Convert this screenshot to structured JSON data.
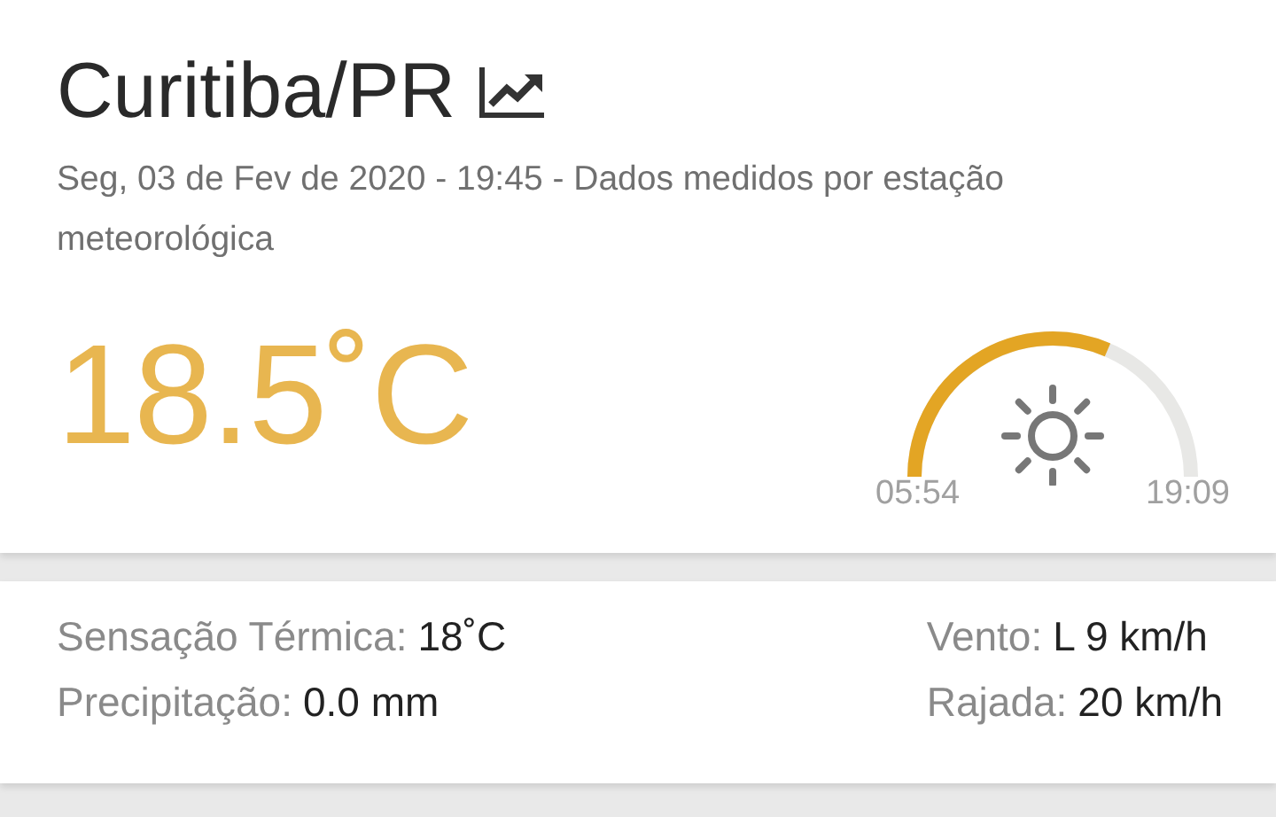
{
  "city": "Curitiba/PR",
  "subtitle": "Seg, 03 de Fev de 2020 - 19:45 - Dados medidos por estação meteorológica",
  "temperature": "18.5˚C",
  "sun": {
    "sunrise": "05:54",
    "sunset": "19:09"
  },
  "stats": [
    {
      "label": "Sensação Térmica:",
      "value": "18˚C"
    },
    {
      "label": "Vento:",
      "value": "L 9 km/h"
    },
    {
      "label": "Precipitação:",
      "value": "0.0 mm"
    },
    {
      "label": "Rajada:",
      "value": "20 km/h"
    }
  ]
}
